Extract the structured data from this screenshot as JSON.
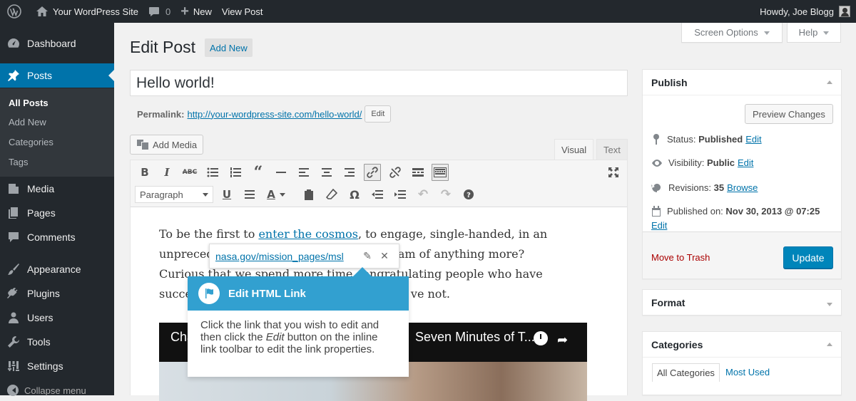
{
  "adminbar": {
    "site_name": "Your WordPress Site",
    "comments_count": "0",
    "new_label": "New",
    "view_post_label": "View Post",
    "howdy": "Howdy, Joe Blogg"
  },
  "sidebar": {
    "items": [
      {
        "label": "Dashboard",
        "icon": "dashboard-icon"
      },
      {
        "label": "Posts",
        "icon": "pin-icon"
      },
      {
        "label": "Media",
        "icon": "media-icon"
      },
      {
        "label": "Pages",
        "icon": "pages-icon"
      },
      {
        "label": "Comments",
        "icon": "comments-icon"
      },
      {
        "label": "Appearance",
        "icon": "paintbrush-icon"
      },
      {
        "label": "Plugins",
        "icon": "plug-icon"
      },
      {
        "label": "Users",
        "icon": "users-icon"
      },
      {
        "label": "Tools",
        "icon": "wrench-icon"
      },
      {
        "label": "Settings",
        "icon": "settings-icon"
      }
    ],
    "submenu": [
      "All Posts",
      "Add New",
      "Categories",
      "Tags"
    ],
    "collapse_label": "Collapse menu"
  },
  "header": {
    "screen_options": "Screen Options",
    "help": "Help",
    "page_title": "Edit Post",
    "add_new": "Add New"
  },
  "post": {
    "title": "Hello world!",
    "permalink_label": "Permalink:",
    "permalink_url": "http://your-wordpress-site.com/hello-world/",
    "permalink_edit": "Edit"
  },
  "editor": {
    "add_media": "Add Media",
    "tab_visual": "Visual",
    "tab_text": "Text",
    "format_select": "Paragraph",
    "content_link_text": "enter the cosmos",
    "content_pre": "To be the first to ",
    "content_post": ", to engage, single-handed, in an",
    "line2_a": "unpreced",
    "line2_b": "he dream of anything more?",
    "line3_a": "Curious that we spend more time c",
    "line3_b": "ongratulating people who have",
    "line4_a": "succe",
    "line4_b": "ve not.",
    "video_title_a": "Cha",
    "video_title_b": "Seven Minutes of T..."
  },
  "link_toolbar": {
    "url": "nasa.gov/mission_pages/msl"
  },
  "pointer": {
    "title": "Edit HTML Link",
    "body_pre": "Click the link that you wish to edit and then click the ",
    "body_em": "Edit",
    "body_post": " button on the inline link toolbar to edit the link properties."
  },
  "publish": {
    "title": "Publish",
    "preview": "Preview Changes",
    "status_label": "Status:",
    "status_value": "Published",
    "visibility_label": "Visibility:",
    "visibility_value": "Public",
    "revisions_label": "Revisions:",
    "revisions_value": "35",
    "browse": "Browse",
    "published_label": "Published on:",
    "published_value": "Nov 30, 2013 @ 07:25",
    "edit": "Edit",
    "trash": "Move to Trash",
    "update": "Update"
  },
  "format_box": {
    "title": "Format"
  },
  "categories_box": {
    "title": "Categories",
    "tab_all": "All Categories",
    "tab_most": "Most Used"
  }
}
